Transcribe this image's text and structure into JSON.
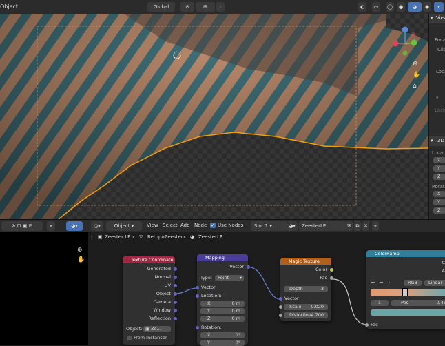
{
  "top_header": {
    "mode_label": "Object",
    "orientation_label": "Global"
  },
  "right_panel": {
    "tab_view": "View",
    "label_focal": "Focal",
    "label_clip": "Clip",
    "label_local": "Local",
    "label_lock": "Lock",
    "section_3d": "3D",
    "label_location": "Location",
    "label_rotation": "Rotation",
    "axes": [
      "X",
      "Y",
      "Z"
    ]
  },
  "node_header": {
    "object_dropdown": "Object",
    "menus": [
      "View",
      "Select",
      "Add",
      "Node"
    ],
    "use_nodes_label": "Use Nodes",
    "slot_label": "Slot 1",
    "material_name": "ZeesterLP"
  },
  "breadcrumb": {
    "items": [
      "Zeester LP",
      "RetopoZeester",
      "ZeesterLP"
    ]
  },
  "nodes": {
    "texture_coordinate": {
      "title": "Texture Coordinate",
      "outputs": [
        "Generated",
        "Normal",
        "UV",
        "Object",
        "Camera",
        "Window",
        "Reflection"
      ],
      "object_label": "Object:",
      "object_value": "Ze...",
      "from_instancer": "From Instancer",
      "header_color": "#a02842"
    },
    "mapping": {
      "title": "Mapping",
      "output": "Vector",
      "type_label": "Type:",
      "type_value": "Point",
      "input_vector": "Vector",
      "location_label": "Location:",
      "location": [
        {
          "axis": "X",
          "value": "0 m"
        },
        {
          "axis": "Y",
          "value": "0 m"
        },
        {
          "axis": "Z",
          "value": "0 m"
        }
      ],
      "rotation_label": "Rotation:",
      "rotation": [
        {
          "axis": "X",
          "value": "0°"
        },
        {
          "axis": "Y",
          "value": "0°"
        }
      ],
      "header_color": "#4a3d99"
    },
    "magic_texture": {
      "title": "Magic Texture",
      "outputs": [
        "Color",
        "Fac"
      ],
      "depth_label": "Depth",
      "depth_value": "3",
      "input_vector": "Vector",
      "scale_label": "Scale",
      "scale_value": "0.020",
      "distortion_label": "Distortion",
      "distortion_value": "-4.700",
      "header_color": "#b0601c"
    },
    "color_ramp": {
      "title": "ColorRamp",
      "out_color": "C",
      "out_alpha": "A",
      "mode_value": "RGB",
      "interp_value": "Linear",
      "index_value": "1",
      "pos_label": "Pos",
      "pos_value": "0.45",
      "input_fac": "Fac",
      "header_color": "#2f7f9a"
    }
  },
  "colors": {
    "selection_outline": "#f5a000",
    "link": "#c8c8c8",
    "link_selected": "#6b7fd6"
  }
}
